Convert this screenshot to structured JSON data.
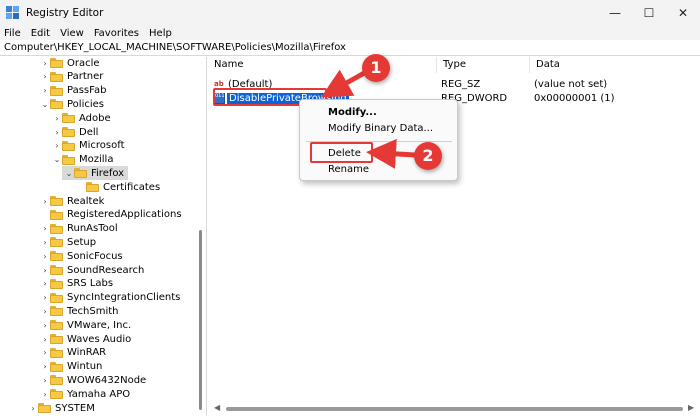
{
  "window": {
    "title": "Registry Editor",
    "controls": {
      "minimize": "—",
      "maximize": "☐",
      "close": "✕"
    }
  },
  "menu": [
    "File",
    "Edit",
    "View",
    "Favorites",
    "Help"
  ],
  "address": "Computer\\HKEY_LOCAL_MACHINE\\SOFTWARE\\Policies\\Mozilla\\Firefox",
  "tree": [
    {
      "label": "Oracle",
      "level": 0,
      "expander": ">"
    },
    {
      "label": "Partner",
      "level": 0,
      "expander": ">"
    },
    {
      "label": "PassFab",
      "level": 0,
      "expander": ">"
    },
    {
      "label": "Policies",
      "level": 0,
      "expander": "v"
    },
    {
      "label": "Adobe",
      "level": 1,
      "expander": ">"
    },
    {
      "label": "Dell",
      "level": 1,
      "expander": ">"
    },
    {
      "label": "Microsoft",
      "level": 1,
      "expander": ">"
    },
    {
      "label": "Mozilla",
      "level": 1,
      "expander": "v"
    },
    {
      "label": "Firefox",
      "level": 2,
      "expander": "v",
      "selected": true
    },
    {
      "label": "Certificates",
      "level": 3,
      "expander": ""
    },
    {
      "label": "Realtek",
      "level": 0,
      "expander": ">"
    },
    {
      "label": "RegisteredApplications",
      "level": 0,
      "expander": ""
    },
    {
      "label": "RunAsTool",
      "level": 0,
      "expander": ">"
    },
    {
      "label": "Setup",
      "level": 0,
      "expander": ">"
    },
    {
      "label": "SonicFocus",
      "level": 0,
      "expander": ">"
    },
    {
      "label": "SoundResearch",
      "level": 0,
      "expander": ">"
    },
    {
      "label": "SRS Labs",
      "level": 0,
      "expander": ">"
    },
    {
      "label": "SyncIntegrationClients",
      "level": 0,
      "expander": ">"
    },
    {
      "label": "TechSmith",
      "level": 0,
      "expander": ">"
    },
    {
      "label": "VMware, Inc.",
      "level": 0,
      "expander": ">"
    },
    {
      "label": "Waves Audio",
      "level": 0,
      "expander": ">"
    },
    {
      "label": "WinRAR",
      "level": 0,
      "expander": ">"
    },
    {
      "label": "Wintun",
      "level": 0,
      "expander": ">"
    },
    {
      "label": "WOW6432Node",
      "level": 0,
      "expander": ">"
    },
    {
      "label": "Yamaha APO",
      "level": 0,
      "expander": ">"
    },
    {
      "label": "SYSTEM",
      "level": -1,
      "expander": ">"
    }
  ],
  "columns": {
    "name": "Name",
    "type": "Type",
    "data": "Data"
  },
  "values": [
    {
      "icon": "string-value-icon",
      "icon_text": "ab",
      "name": "(Default)",
      "type": "REG_SZ",
      "data": "(value not set)"
    },
    {
      "icon": "binary-value-icon",
      "icon_text": "011 110",
      "name": "DisablePrivateBrowsing",
      "type": "REG_DWORD",
      "data": "0x00000001 (1)",
      "selected": true
    }
  ],
  "context_menu": {
    "items": [
      "Modify...",
      "Modify Binary Data...",
      "Delete",
      "Rename"
    ]
  },
  "callouts": [
    "1",
    "2"
  ],
  "colors": {
    "accent": "#0a64d6",
    "annotation": "#e53935",
    "folder": "#f6c945"
  }
}
